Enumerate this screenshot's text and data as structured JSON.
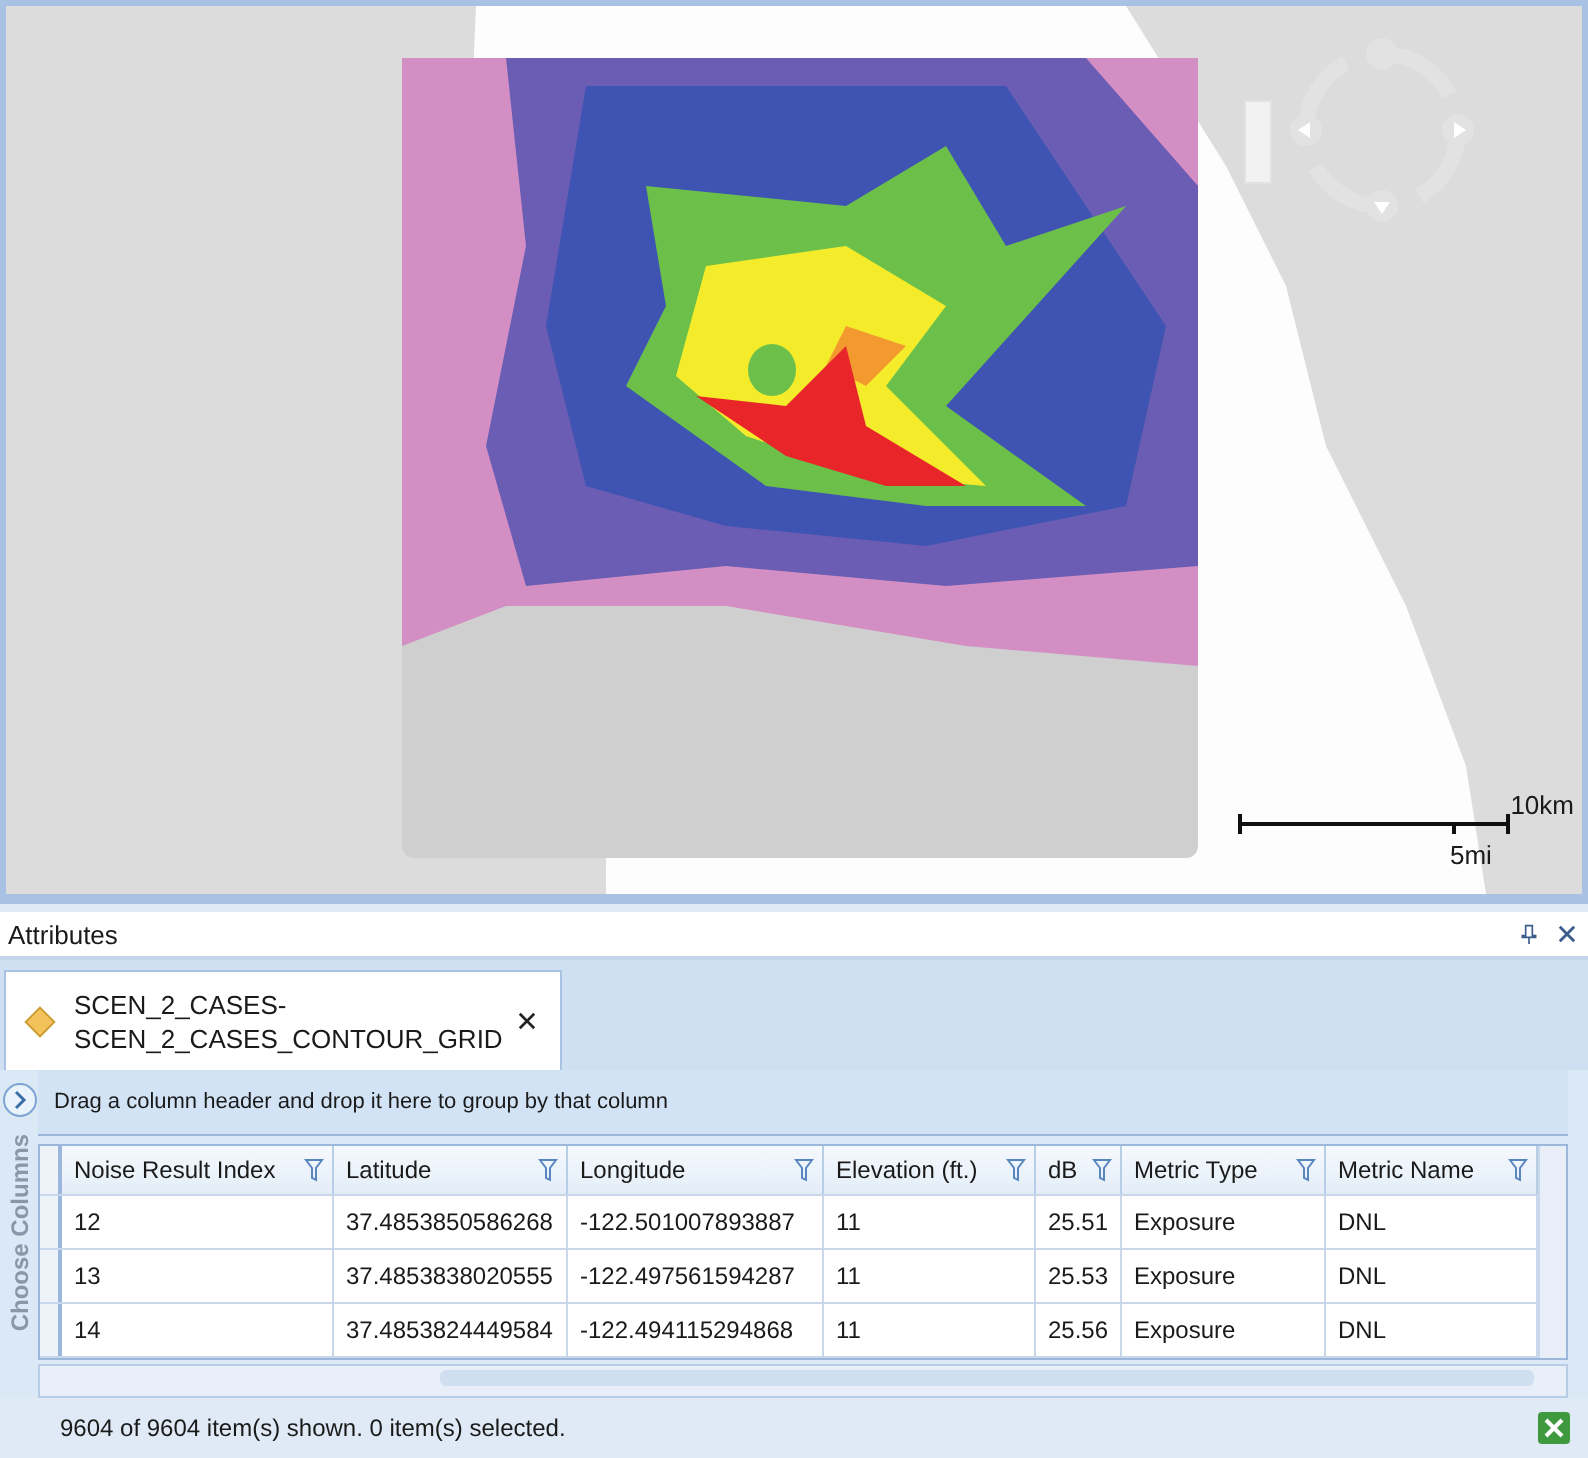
{
  "map": {
    "scale_bar": {
      "major_label": "10km",
      "minor_label": "5mi"
    }
  },
  "panel": {
    "title": "Attributes"
  },
  "document_tab": {
    "line_1": "SCEN_2_CASES-",
    "line_2": "SCEN_2_CASES_CONTOUR_GRID",
    "selected": true
  },
  "grid": {
    "group_hint": "Drag a column header and drop it here to group by that column",
    "side_label": "Choose Columns",
    "columns": [
      "Noise Result Index",
      "Latitude",
      "Longitude",
      "Elevation (ft.)",
      "dB",
      "Metric Type",
      "Metric Name"
    ],
    "rows": [
      [
        "12",
        "37.4853850586268",
        "-122.501007893887",
        "11",
        "25.51",
        "Exposure",
        "DNL"
      ],
      [
        "13",
        "37.4853838020555",
        "-122.497561594287",
        "11",
        "25.53",
        "Exposure",
        "DNL"
      ],
      [
        "14",
        "37.4853824449584",
        "-122.494115294868",
        "11",
        "25.56",
        "Exposure",
        "DNL"
      ]
    ]
  },
  "status_bar": {
    "text": "9604 of 9604 item(s) shown. 0 item(s) selected."
  }
}
